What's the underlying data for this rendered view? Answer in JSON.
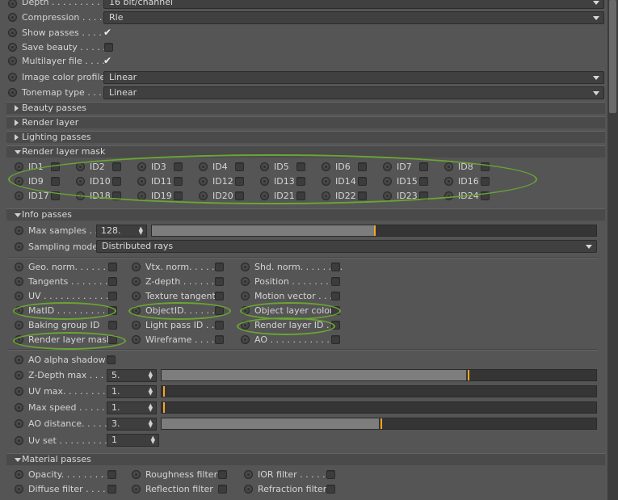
{
  "top_rows": [
    {
      "label": "Depth . . . . . . . . .",
      "value": "16 bit/channel",
      "type": "dropdown"
    },
    {
      "label": "Compression . . . .",
      "value": "Rle",
      "type": "dropdown"
    },
    {
      "label": "Show passes . . . .",
      "type": "check",
      "checked": true
    },
    {
      "label": "Save beauty . . . . .",
      "type": "check",
      "checked": false
    },
    {
      "label": "Multilayer file . . . .",
      "type": "check",
      "checked": true
    },
    {
      "label": "Image color profile",
      "value": "Linear",
      "type": "dropdown"
    },
    {
      "label": "Tonemap type . . . .",
      "value": "Linear",
      "type": "dropdown"
    }
  ],
  "sections": {
    "beauty": "Beauty passes",
    "render_layer": "Render layer",
    "lighting": "Lighting passes",
    "render_layer_mask": "Render layer mask",
    "info": "Info passes",
    "material": "Material passes"
  },
  "ids": [
    "ID1",
    "ID2",
    "ID3",
    "ID4",
    "ID5",
    "ID6",
    "ID7",
    "ID8",
    "ID9",
    "ID10",
    "ID11",
    "ID12",
    "ID13",
    "ID14",
    "ID15",
    "ID16",
    "ID17",
    "ID18",
    "ID19",
    "ID20",
    "ID21",
    "ID22",
    "ID23",
    "ID24"
  ],
  "info": {
    "max_samples_label": "Max samples . .",
    "max_samples_value": "128.",
    "max_samples_level": 0.5,
    "sampling_mode_label": "Sampling mode",
    "sampling_mode_value": "Distributed rays",
    "passes": [
      [
        "Geo. norm. . . . . . . .",
        "Vtx. norm. . . . . .",
        "Shd. norm. . . . . . . ."
      ],
      [
        "Tangents . . . . . . . .",
        "Z-depth . . . . . . .",
        "Position . . . . . . . . ."
      ],
      [
        "UV . . . . . . . . . . . . .",
        "Texture tangent",
        "Motion vector . . . ."
      ],
      [
        "MatID . . . . . . . . . .",
        "ObjectID. . . . . . .",
        "Object layer color"
      ],
      [
        "Baking group ID",
        "Light pass ID . . .",
        "Render layer ID . . ."
      ],
      [
        "Render layer mask",
        "Wireframe . . . .",
        "AO . . . . . . . . . . . ."
      ]
    ],
    "ao_alpha_shadow": "AO alpha shadow",
    "sliders": [
      {
        "label": "Z-Depth max . . . .",
        "value": "5.",
        "level": 0.7
      },
      {
        "label": "UV max. . . . . . . . .",
        "value": "1.",
        "level": 0.0
      },
      {
        "label": "Max speed . . . . . .",
        "value": "1.",
        "level": 0.0
      },
      {
        "label": "AO distance. . . . . .",
        "value": "3.",
        "level": 0.5
      }
    ],
    "uv_set_label": "Uv set . . . . . . . . . .",
    "uv_set_value": "1"
  },
  "material": [
    [
      "Opacity. . . . . . . . .",
      "Roughness filter",
      "IOR filter . . . . . ."
    ],
    [
      "Diffuse filter . . . .",
      "Reflection filter",
      "Refraction filter"
    ]
  ],
  "colors": {
    "highlight": "#6aa632",
    "accent": "#f5a623",
    "panel": "#555555",
    "header": "#4a4a4a"
  }
}
